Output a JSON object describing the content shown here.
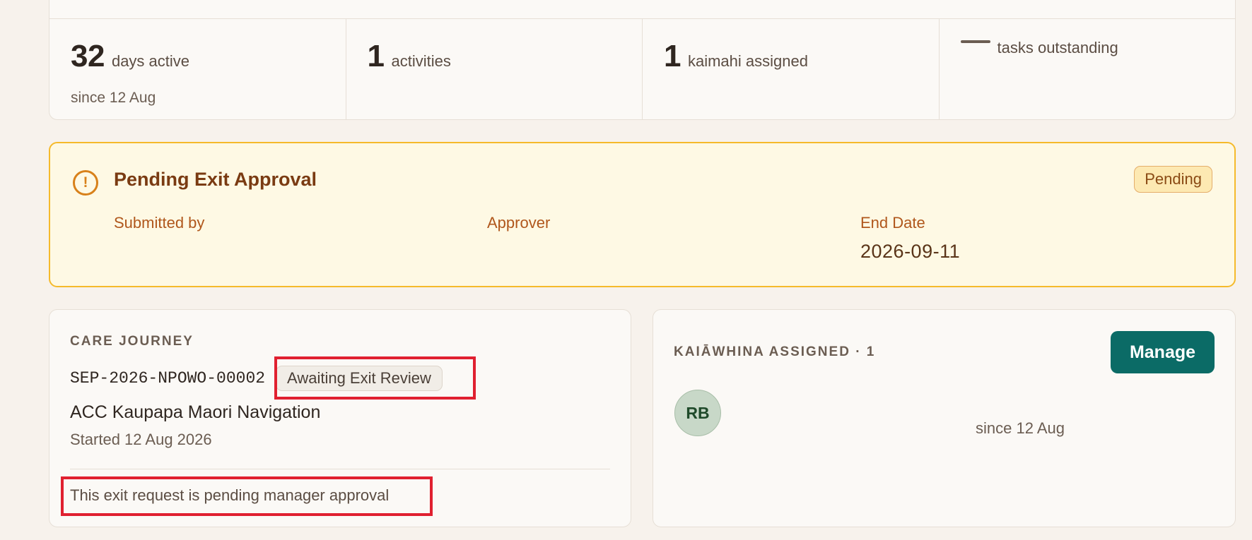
{
  "stats": [
    {
      "number": "32",
      "label": "days active",
      "sub": "since 12 Aug"
    },
    {
      "number": "1",
      "label": "activities"
    },
    {
      "number": "1",
      "label": "kaimahi assigned"
    },
    {
      "number": "",
      "label": "tasks outstanding"
    }
  ],
  "pending": {
    "title": "Pending Exit Approval",
    "badge": "Pending",
    "fields": {
      "submitted_by_label": "Submitted by",
      "approver_label": "Approver",
      "end_date_label": "End Date",
      "end_date_value": "2026-09-11"
    },
    "colors": {
      "border": "#f5ba2b",
      "background": "#fef9e4",
      "icon": "#d8811a"
    }
  },
  "journey": {
    "section_label": "CARE JOURNEY",
    "reference": "SEP-2026-NPOWO-00002",
    "status_badge": "Awaiting Exit Review",
    "name": "ACC Kaupapa Maori Navigation",
    "started": "Started 12 Aug 2026",
    "note": "This exit request is pending manager approval"
  },
  "assigned": {
    "section_label": "KAIĀWHINA ASSIGNED · 1",
    "manage_label": "Manage",
    "member_initials": "RB",
    "member_since": "since 12 Aug",
    "colors": {
      "manage_button": "#0b6b66",
      "avatar_bg": "#c8d8c8"
    }
  },
  "icons": {
    "warning": "exclamation-circle-icon"
  },
  "highlight_color": "#e02030"
}
